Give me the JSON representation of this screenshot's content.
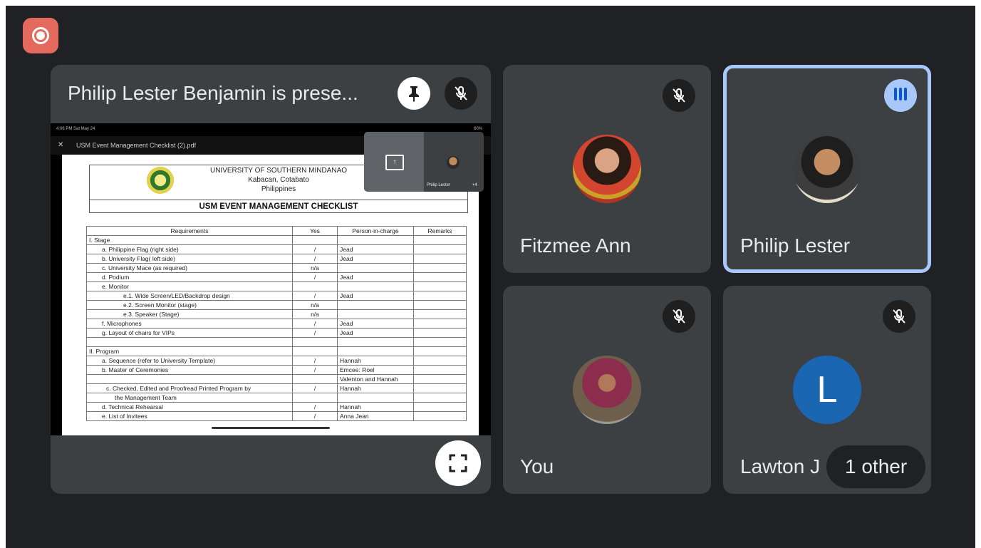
{
  "presentation": {
    "title": "Philip Lester Benjamin is prese...",
    "device_status": {
      "time": "4:06 PM  Sat May 24",
      "battery": "60%"
    },
    "document": {
      "file_name": "USM Event Management Checklist (2).pdf",
      "header_lines": [
        "UNIVERSITY OF SOUTHERN MINDANAO",
        "Kabacan, Cotabato",
        "Philippines"
      ],
      "doc_title": "USM EVENT MANAGEMENT CHECKLIST",
      "columns": [
        "Requirements",
        "Yes",
        "Person-in-charge",
        "Remarks"
      ],
      "rows": [
        [
          "I. Stage",
          "",
          "",
          ""
        ],
        [
          "a. Philippine Flag (right side)",
          "/",
          "Jead",
          ""
        ],
        [
          "b. University Flag( left side)",
          "/",
          "Jead",
          ""
        ],
        [
          "c. University Mace (as required)",
          "n/a",
          "",
          ""
        ],
        [
          "d. Podium",
          "/",
          "Jead",
          ""
        ],
        [
          "e. Monitor",
          "",
          "",
          ""
        ],
        [
          "e.1. Wide Screen/LED/Backdrop design",
          "/",
          "Jead",
          ""
        ],
        [
          "e.2. Screen Monitor (stage)",
          "n/a",
          "",
          ""
        ],
        [
          "e.3. Speaker (Stage)",
          "n/a",
          "",
          ""
        ],
        [
          "f. Microphones",
          "/",
          "Jead",
          ""
        ],
        [
          "g. Layout of chairs for VIPs",
          "/",
          "Jead",
          ""
        ],
        [
          "",
          "",
          "",
          ""
        ],
        [
          "II. Program",
          "",
          "",
          ""
        ],
        [
          "a. Sequence (refer to University Template)",
          "/",
          "Hannah",
          ""
        ],
        [
          "b. Master of Ceremonies",
          "/",
          "Emcee: Roel",
          ""
        ],
        [
          "",
          "",
          "Valenton and Hannah",
          ""
        ],
        [
          "c. Checked, Edited and Proofread Printed Program by",
          "/",
          "Hannah",
          ""
        ],
        [
          "the Management Team",
          "",
          "",
          ""
        ],
        [
          "d. Technical Rehearsal",
          "/",
          "Hannah",
          ""
        ],
        [
          "e. List of Invitees",
          "/",
          "Anna Jean",
          ""
        ]
      ]
    },
    "pip": {
      "name": "Philip Lester",
      "count": "+4"
    }
  },
  "participants": [
    {
      "name": "Fitzmee Ann",
      "muted": true,
      "speaking": false
    },
    {
      "name": "Philip Lester",
      "muted": false,
      "speaking": true
    },
    {
      "name": "You",
      "muted": true,
      "speaking": false
    },
    {
      "name": "Lawton J",
      "initial": "L",
      "muted": true,
      "speaking": false
    }
  ],
  "others_pill": "1 other",
  "colors": {
    "background": "#202124",
    "tile": "#3c4043",
    "record_button": "#e46a5e",
    "active_speaker_border": "#a8c7fa",
    "avatar_l": "#1a66b3"
  },
  "icons": {
    "record": "record-icon",
    "pin": "pin-icon",
    "mic_off": "mic-off-icon",
    "fullscreen": "fullscreen-icon",
    "speaking": "audio-bars-icon"
  }
}
